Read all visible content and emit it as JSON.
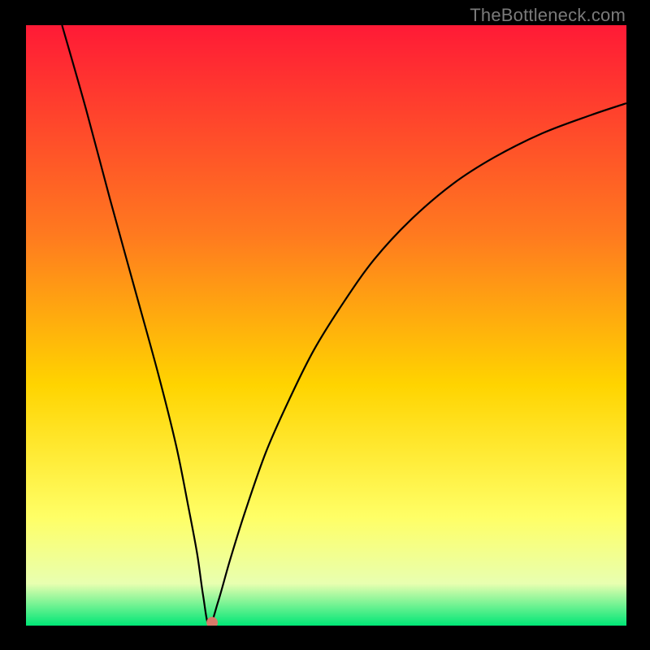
{
  "watermark": "TheBottleneck.com",
  "chart_data": {
    "type": "line",
    "title": "",
    "xlabel": "",
    "ylabel": "",
    "xlim": [
      0,
      100
    ],
    "ylim": [
      0,
      100
    ],
    "plot_background_gradient": {
      "top": "#ff1a36",
      "mid_upper": "#ff7a1f",
      "mid": "#ffd400",
      "lower": "#ffff66",
      "near_bottom": "#e8ffb0",
      "bottom": "#00e676"
    },
    "curve": {
      "minimum_x": 30.5,
      "minimum_y": 0,
      "points_percent": [
        {
          "x": 6.0,
          "y": 100.0
        },
        {
          "x": 10.0,
          "y": 86.0
        },
        {
          "x": 14.0,
          "y": 71.0
        },
        {
          "x": 18.0,
          "y": 56.5
        },
        {
          "x": 22.0,
          "y": 42.0
        },
        {
          "x": 25.0,
          "y": 30.0
        },
        {
          "x": 27.0,
          "y": 20.0
        },
        {
          "x": 28.5,
          "y": 12.0
        },
        {
          "x": 29.5,
          "y": 5.0
        },
        {
          "x": 30.5,
          "y": 0.0
        },
        {
          "x": 32.0,
          "y": 4.0
        },
        {
          "x": 34.0,
          "y": 11.0
        },
        {
          "x": 36.5,
          "y": 19.0
        },
        {
          "x": 40.0,
          "y": 29.0
        },
        {
          "x": 44.0,
          "y": 38.0
        },
        {
          "x": 48.0,
          "y": 46.0
        },
        {
          "x": 53.0,
          "y": 54.0
        },
        {
          "x": 58.0,
          "y": 61.0
        },
        {
          "x": 64.0,
          "y": 67.5
        },
        {
          "x": 71.0,
          "y": 73.5
        },
        {
          "x": 78.0,
          "y": 78.0
        },
        {
          "x": 86.0,
          "y": 82.0
        },
        {
          "x": 94.0,
          "y": 85.0
        },
        {
          "x": 100.0,
          "y": 87.0
        }
      ]
    },
    "marker": {
      "x_percent": 31.0,
      "y_percent": 0.5,
      "color": "#d87a6a",
      "radius_px": 7
    }
  }
}
